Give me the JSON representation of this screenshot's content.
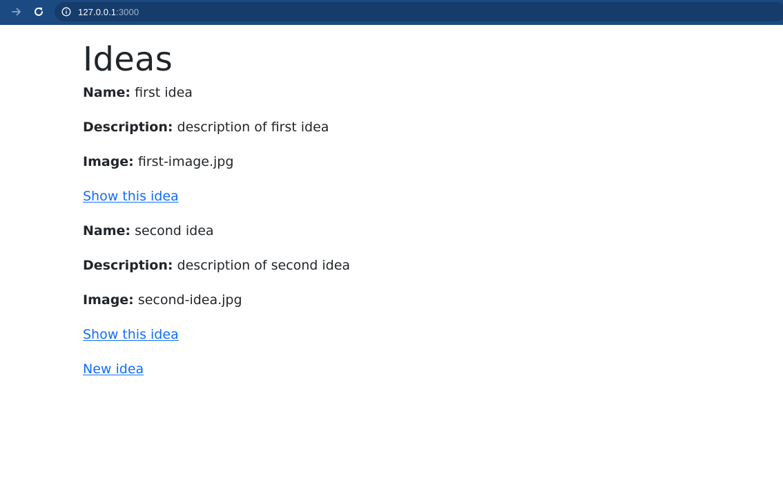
{
  "browser": {
    "url_host": "127.0.0.1",
    "url_port": ":3000",
    "bar_color": "#1b4a82",
    "icons": [
      "arrow-forward-icon",
      "reload-icon",
      "info-icon"
    ]
  },
  "page": {
    "title": "Ideas",
    "ideas": [
      {
        "name_label": "Name:",
        "name": "first idea",
        "description_label": "Description:",
        "description": "description of first idea",
        "image_label": "Image:",
        "image": "first-image.jpg",
        "show_link": "Show this idea"
      },
      {
        "name_label": "Name:",
        "name": "second idea",
        "description_label": "Description:",
        "description": "description of second idea",
        "image_label": "Image:",
        "image": "second-idea.jpg",
        "show_link": "Show this idea"
      }
    ],
    "new_link": "New idea",
    "link_color": "#0d6efd"
  }
}
